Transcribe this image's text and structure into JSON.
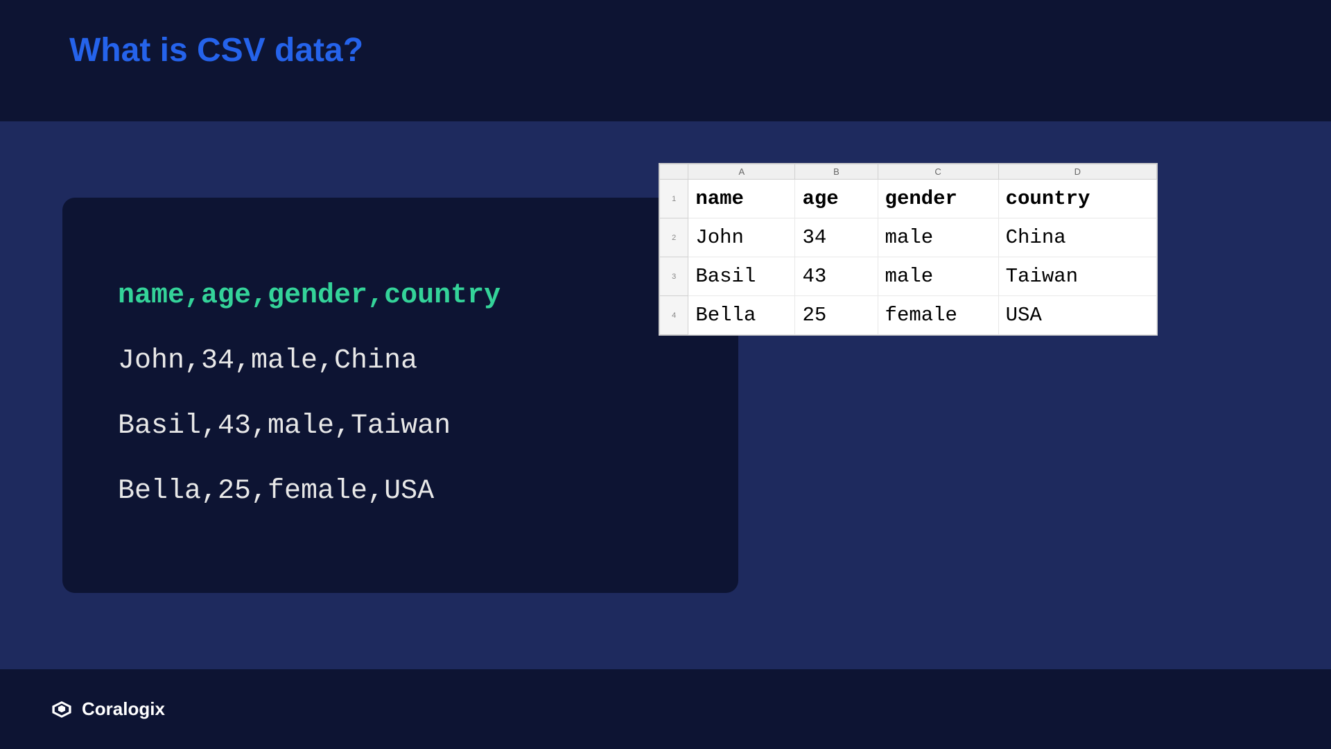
{
  "title": "What is CSV data?",
  "code": {
    "header": "name,age,gender,country",
    "rows": [
      "John,34,male,China",
      "Basil,43,male,Taiwan",
      "Bella,25,female,USA"
    ]
  },
  "spreadsheet": {
    "columns": [
      "A",
      "B",
      "C",
      "D"
    ],
    "rows": [
      {
        "num": "1",
        "cells": [
          "name",
          "age",
          "gender",
          "country"
        ],
        "bold": true
      },
      {
        "num": "2",
        "cells": [
          "John",
          "34",
          "male",
          "China"
        ],
        "bold": false
      },
      {
        "num": "3",
        "cells": [
          "Basil",
          "43",
          "male",
          "Taiwan"
        ],
        "bold": false
      },
      {
        "num": "4",
        "cells": [
          "Bella",
          "25",
          "female",
          "USA"
        ],
        "bold": false
      }
    ]
  },
  "brand": "Coralogix"
}
